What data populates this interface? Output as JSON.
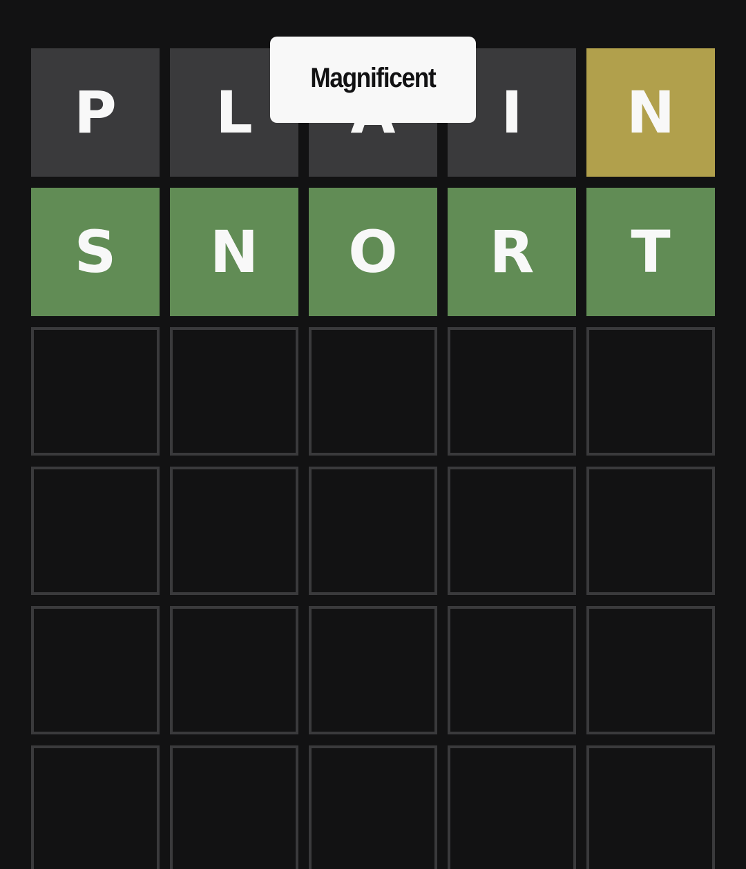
{
  "toast": {
    "message": "Magnificent"
  },
  "colors": {
    "background": "#121213",
    "absent": "#3a3a3c",
    "present": "#b1a04c",
    "correct": "#618c55",
    "empty_border": "#3a3a3c",
    "tile_text": "#f8f8f8",
    "toast_background": "#f8f8f8",
    "toast_text": "#121213"
  },
  "board": {
    "rows": [
      {
        "tiles": [
          {
            "letter": "P",
            "state": "absent"
          },
          {
            "letter": "L",
            "state": "absent"
          },
          {
            "letter": "A",
            "state": "absent"
          },
          {
            "letter": "I",
            "state": "absent"
          },
          {
            "letter": "N",
            "state": "present"
          }
        ]
      },
      {
        "tiles": [
          {
            "letter": "S",
            "state": "correct"
          },
          {
            "letter": "N",
            "state": "correct"
          },
          {
            "letter": "O",
            "state": "correct"
          },
          {
            "letter": "R",
            "state": "correct"
          },
          {
            "letter": "T",
            "state": "correct"
          }
        ]
      },
      {
        "tiles": [
          {
            "letter": "",
            "state": "empty"
          },
          {
            "letter": "",
            "state": "empty"
          },
          {
            "letter": "",
            "state": "empty"
          },
          {
            "letter": "",
            "state": "empty"
          },
          {
            "letter": "",
            "state": "empty"
          }
        ]
      },
      {
        "tiles": [
          {
            "letter": "",
            "state": "empty"
          },
          {
            "letter": "",
            "state": "empty"
          },
          {
            "letter": "",
            "state": "empty"
          },
          {
            "letter": "",
            "state": "empty"
          },
          {
            "letter": "",
            "state": "empty"
          }
        ]
      },
      {
        "tiles": [
          {
            "letter": "",
            "state": "empty"
          },
          {
            "letter": "",
            "state": "empty"
          },
          {
            "letter": "",
            "state": "empty"
          },
          {
            "letter": "",
            "state": "empty"
          },
          {
            "letter": "",
            "state": "empty"
          }
        ]
      },
      {
        "tiles": [
          {
            "letter": "",
            "state": "empty"
          },
          {
            "letter": "",
            "state": "empty"
          },
          {
            "letter": "",
            "state": "empty"
          },
          {
            "letter": "",
            "state": "empty"
          },
          {
            "letter": "",
            "state": "empty"
          }
        ]
      }
    ]
  }
}
